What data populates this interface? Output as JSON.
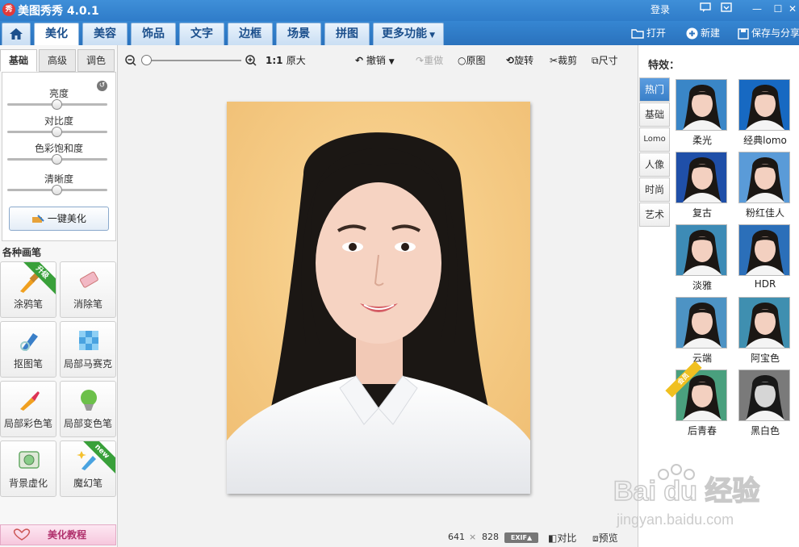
{
  "titlebar": {
    "app_logo": "秀",
    "title": "美图秀秀 4.0.1",
    "login": "登录",
    "minimize": "—",
    "restore": "☐",
    "close": "✕"
  },
  "tabs": [
    "美化",
    "美容",
    "饰品",
    "文字",
    "边框",
    "场景",
    "拼图",
    "更多功能"
  ],
  "top_actions": {
    "open": "打开",
    "new": "新建",
    "save_share": "保存与分享"
  },
  "left": {
    "subtabs": [
      "基础",
      "高级",
      "调色"
    ],
    "sliders": [
      {
        "label": "亮度",
        "value": 0.5
      },
      {
        "label": "对比度",
        "value": 0.5
      },
      {
        "label": "色彩饱和度",
        "value": 0.5
      },
      {
        "label": "清晰度",
        "value": 0.5
      }
    ],
    "one_key": "一键美化",
    "section_title": "各种画笔",
    "brushes": [
      {
        "label": "涂鸦笔",
        "badge": "升级"
      },
      {
        "label": "消除笔",
        "badge": ""
      },
      {
        "label": "抠图笔",
        "badge": ""
      },
      {
        "label": "局部马赛克",
        "badge": ""
      },
      {
        "label": "局部彩色笔",
        "badge": ""
      },
      {
        "label": "局部变色笔",
        "badge": ""
      },
      {
        "label": "背景虚化",
        "badge": ""
      },
      {
        "label": "魔幻笔",
        "badge": "new"
      }
    ],
    "tutorial": "美化教程"
  },
  "center": {
    "actual_size": "1:1",
    "original_size": "原大",
    "tools": {
      "undo": "撤销",
      "redo": "重做",
      "original": "原图",
      "rotate": "旋转",
      "crop": "裁剪",
      "resize": "尺寸"
    },
    "image_width": "641",
    "image_times": "×",
    "image_height": "828",
    "exif": "EXIF▲",
    "compare": "对比",
    "preview": "预览"
  },
  "right": {
    "title": "特效：",
    "categories": [
      "热门",
      "基础",
      "Lomo",
      "人像",
      "时尚",
      "艺术"
    ],
    "effects": [
      {
        "label": "柔光",
        "bg": "#3a86c7"
      },
      {
        "label": "经典lomo",
        "bg": "#1769c2"
      },
      {
        "label": "复古",
        "bg": "#1f4fa8"
      },
      {
        "label": "粉红佳人",
        "bg": "#5a9bd8"
      },
      {
        "label": "淡雅",
        "bg": "#3d8bb6"
      },
      {
        "label": "HDR",
        "bg": "#2b6fb9"
      },
      {
        "label": "云端",
        "bg": "#4d93c4"
      },
      {
        "label": "阿宝色",
        "bg": "#3f8fb0"
      },
      {
        "label": "后青春",
        "bg": "#4aa07e",
        "badge": "会员"
      },
      {
        "label": "黑白色",
        "bg": "#7a7a7a"
      }
    ]
  },
  "watermark": {
    "text": "Bai du 经验",
    "url": "jingyan.baidu.com"
  }
}
